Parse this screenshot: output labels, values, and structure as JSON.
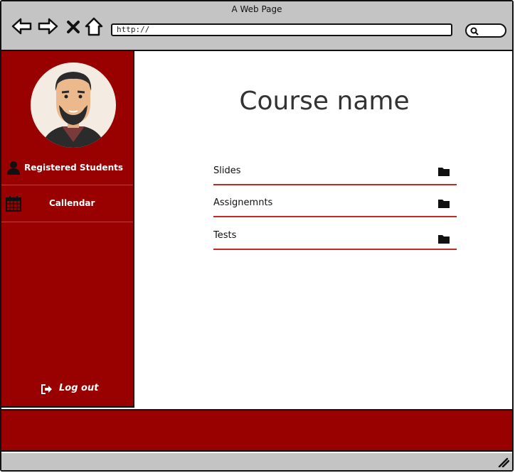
{
  "window": {
    "title": "A Web Page"
  },
  "browser": {
    "url": "http://"
  },
  "sidebar": {
    "items": [
      {
        "label": "Registered Students",
        "icon": "user-icon"
      },
      {
        "label": "Callendar",
        "icon": "calendar-icon"
      }
    ],
    "logout_label": "Log out"
  },
  "main": {
    "title": "Course name",
    "rows": [
      {
        "label": "Slides",
        "icon": "folder-icon"
      },
      {
        "label": "Assignemnts",
        "icon": "folder-icon"
      },
      {
        "label": "Tests",
        "icon": "folder-icon"
      }
    ]
  },
  "colors": {
    "accent": "#990000",
    "underline": "#c62828",
    "chrome": "#c4c4c4"
  }
}
